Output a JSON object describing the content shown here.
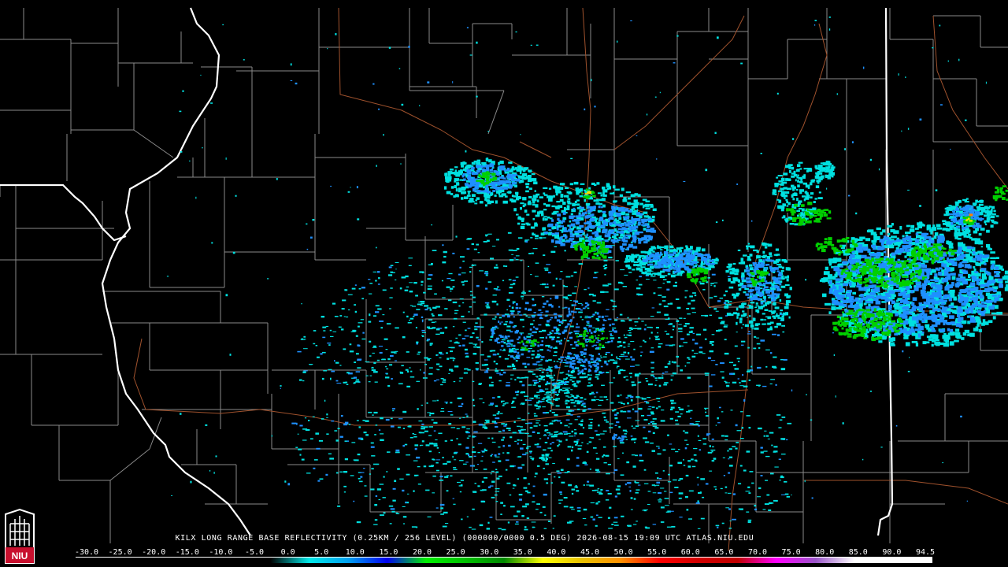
{
  "caption": "KILX LONG RANGE BASE REFLECTIVITY (0.25KM / 256 LEVEL) (000000/0000 0.5 DEG) 2026-08-15 19:09 UTC  ATLAS.NIU.EDU",
  "logo": {
    "text": "NIU",
    "color": "#c8102e"
  },
  "colorbar": {
    "ticks": [
      "-30.0",
      "-25.0",
      "-20.0",
      "-15.0",
      "-10.0",
      "-5.0",
      "0.0",
      "5.0",
      "10.0",
      "15.0",
      "20.0",
      "25.0",
      "30.0",
      "35.0",
      "40.0",
      "45.0",
      "50.0",
      "55.0",
      "60.0",
      "65.0",
      "70.0",
      "75.0",
      "80.0",
      "85.0",
      "90.0",
      "94.5"
    ],
    "colors": [
      "#000000",
      "#000000",
      "#000000",
      "#000000",
      "#000000",
      "#000000",
      "#00e8e8",
      "#00a0f0",
      "#0000f0",
      "#00f000",
      "#00c000",
      "#008800",
      "#ffff00",
      "#e8c000",
      "#ff9000",
      "#ff0000",
      "#d00000",
      "#c00000",
      "#ff00ff",
      "#9955c8",
      "#ffffff",
      "#ffffff",
      "#ffffff"
    ]
  },
  "map": {
    "background": "#000000",
    "county_line_color": "#8a8a8a",
    "state_line_color": "#ffffff",
    "road_color": "#a0522d",
    "echo_colors": {
      "light": "#00e0e0",
      "mid": "#1e90ff",
      "blue": "#0000e0",
      "green": "#00d000",
      "yellow": "#f0e000",
      "orange": "#ff8000"
    }
  }
}
